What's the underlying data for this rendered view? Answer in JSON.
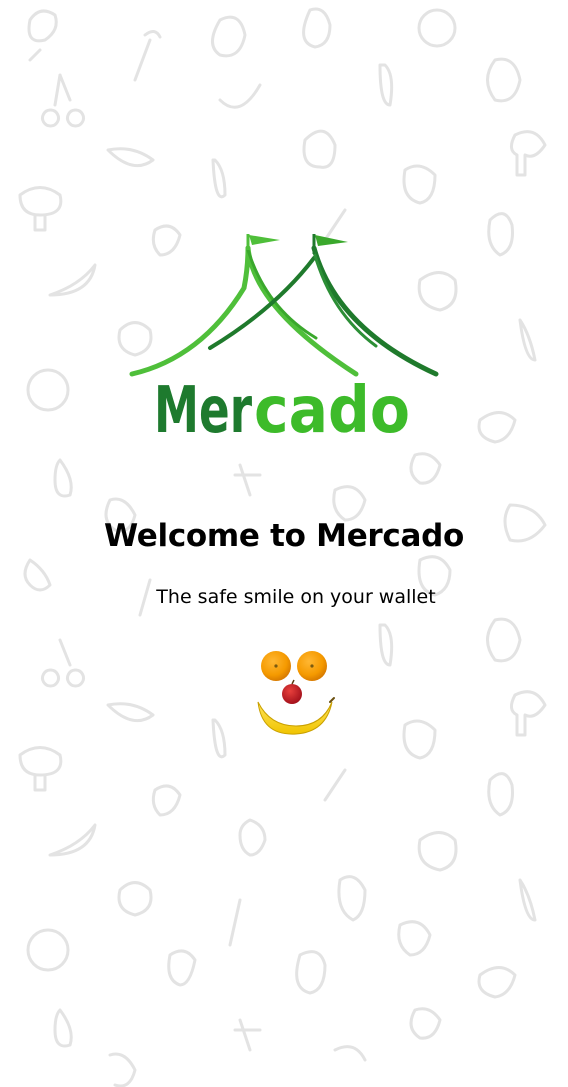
{
  "logo": {
    "text": "Mercado",
    "text_dark_part": "Mer",
    "text_light_part": "cado",
    "colors": {
      "dark_green": "#1e7a2e",
      "light_green": "#3dbb2a",
      "tent_light": "#4fbf3a",
      "tent_dark": "#1f7a2c"
    }
  },
  "welcome": {
    "title": "Welcome to Mercado",
    "subtitle": "The safe smile on your wallet"
  },
  "illustration": {
    "eye_left": "orange-icon",
    "eye_right": "orange-icon",
    "nose": "apple-icon",
    "mouth": "banana-icon"
  },
  "background": {
    "pattern": "fruit-vegetable-doodles",
    "color": "#ffffff",
    "doodle_color": "#ececec"
  }
}
